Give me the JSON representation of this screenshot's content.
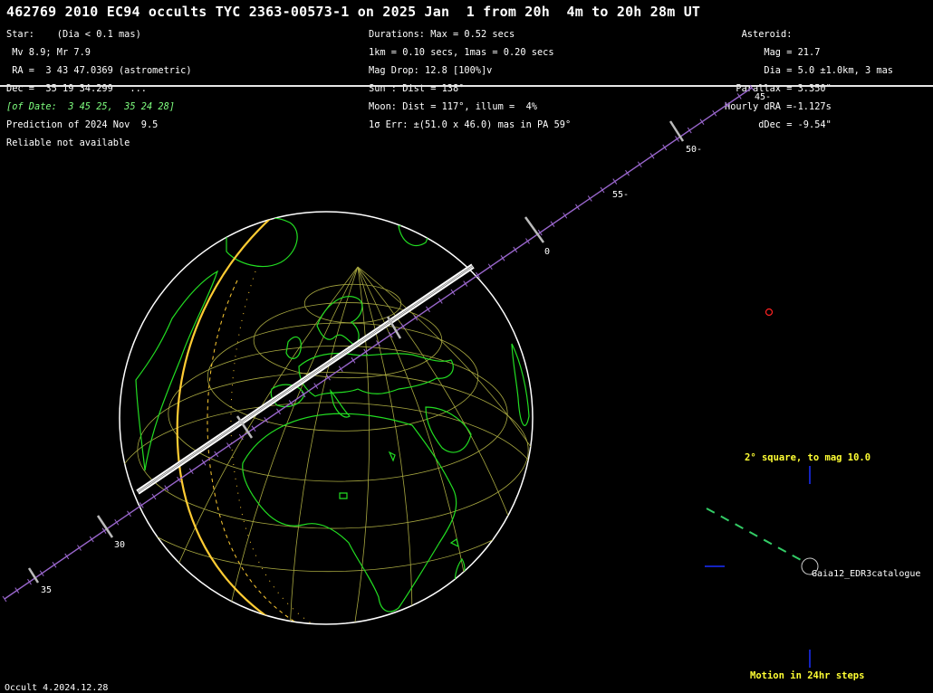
{
  "title": "462769 2010 EC94 occults TYC 2363-00573-1 on 2025 Jan  1 from 20h  4m to 20h 28m UT",
  "star": {
    "line1": "Star:    (Dia < 0.1 mas)",
    "line2": " Mv 8.9; Mr 7.9",
    "line3": " RA =  3 43 47.0369 (astrometric)",
    "line4": "Dec =  35 19 34.299   ...",
    "line5": "[of Date:  3 45 25,  35 24 28]",
    "line6": "Prediction of 2024 Nov  9.5",
    "line7": "Reliable not available"
  },
  "event": {
    "line1": "Durations: Max = 0.52 secs",
    "line2": "1km = 0.10 secs, 1mas = 0.20 secs",
    "line3": "Mag Drop: 12.8 [100%]v",
    "line4": "Sun : Dist = 138°",
    "line5": "Moon: Dist = 117°, illum =  4%",
    "line6": "1σ Err: ±(51.0 x 46.0) mas in PA 59°"
  },
  "asteroid": {
    "line1": "   Asteroid:",
    "line2": "       Mag = 21.7",
    "line3": "       Dia = 5.0 ±1.0km, 3 mas",
    "line4": "  Parallax = 3.350\"",
    "line5": "Hourly dRA =-1.127s",
    "line6": "      dDec = -9.54\""
  },
  "path_ticks": [
    "45-",
    "50-",
    "55-",
    "0",
    "30",
    "35"
  ],
  "star_chart": {
    "caption": "2° square, to mag 10.0",
    "catalogue": "Gaia12_EDR3catalogue",
    "motion_note": "Motion in 24hr steps"
  },
  "footer": "Occult 4.2024.12.28",
  "colors": {
    "coast": "#22dd22",
    "grid": "#a8a840",
    "terminator": "#ffcc33",
    "track": "#9966cc",
    "motion": "#33cc66",
    "star_marker": "#ff2222"
  }
}
